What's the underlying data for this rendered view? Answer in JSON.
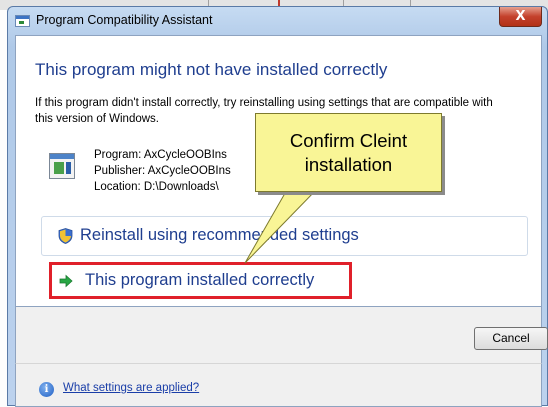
{
  "window": {
    "title": "Program Compatibility Assistant",
    "close_glyph": "X"
  },
  "main": {
    "heading": "This program might not have installed correctly",
    "description": "If this program didn't install correctly, try reinstalling using settings that are compatible with this version of Windows.",
    "program_line": "Program: AxCycleOOBIns",
    "publisher_line": "Publisher: AxCycleOOBIns",
    "location_line": "Location: D:\\Downloads\\",
    "options": {
      "reinstall_label": "Reinstall using recommended settings",
      "installed_label": "This program installed correctly"
    }
  },
  "callout": {
    "text": "Confirm Cleint installation"
  },
  "buttons": {
    "cancel": "Cancel"
  },
  "footer": {
    "link": "What settings are applied?"
  },
  "colors": {
    "heading_blue": "#1f3e8f",
    "highlight_red": "#e0202a",
    "callout_yellow": "#f9f596",
    "close_red": "#c4412c"
  },
  "icons": {
    "title": "window-icon",
    "program": "program-icon",
    "reinstall": "shield-icon",
    "installed": "green-arrow-icon",
    "footer": "info-icon"
  }
}
